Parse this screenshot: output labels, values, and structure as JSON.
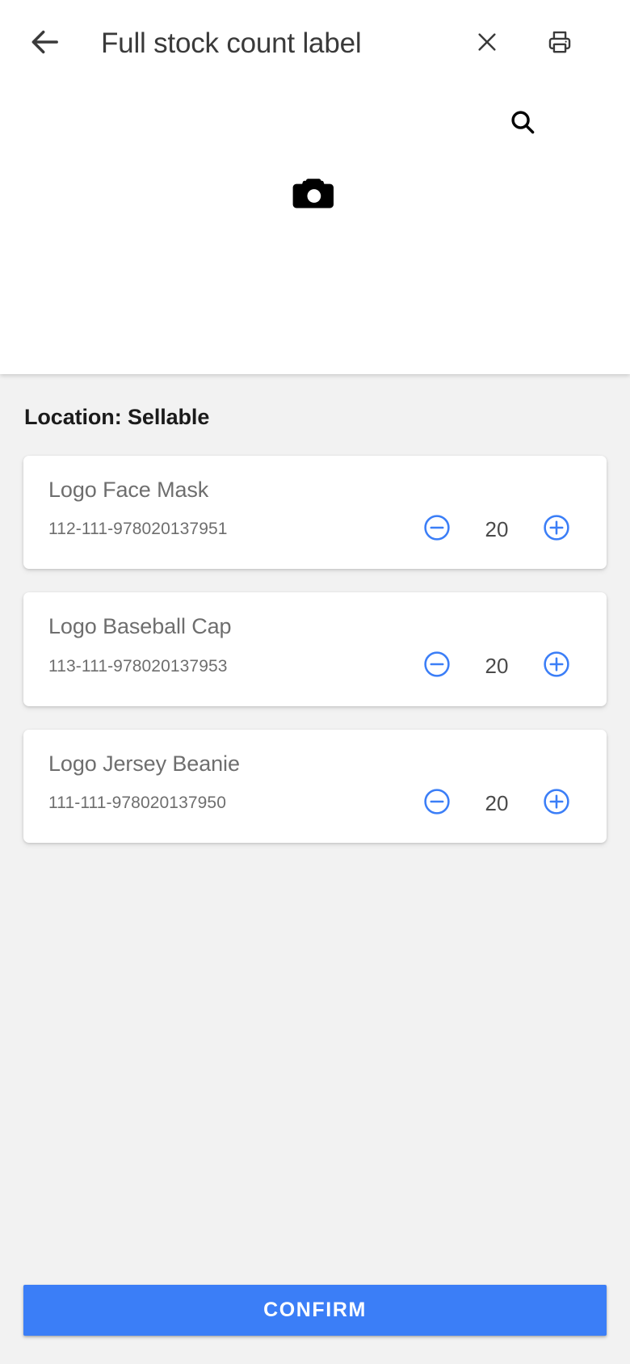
{
  "appbar": {
    "title": "Full stock count label",
    "back_icon": "arrow-left-icon",
    "close_icon": "close-icon",
    "print_icon": "printer-icon"
  },
  "scanner": {
    "search_icon": "search-icon",
    "camera_icon": "camera-icon"
  },
  "content": {
    "location_heading": "Location: Sellable",
    "items": [
      {
        "name": "Logo Face Mask",
        "sku": "112-111-978020137951",
        "quantity": "20",
        "decrement_label": "−",
        "increment_label": "+"
      },
      {
        "name": "Logo Baseball Cap",
        "sku": "113-111-978020137953",
        "quantity": "20",
        "decrement_label": "−",
        "increment_label": "+"
      },
      {
        "name": "Logo Jersey Beanie",
        "sku": "111-111-978020137950",
        "quantity": "20",
        "decrement_label": "−",
        "increment_label": "+"
      }
    ]
  },
  "footer": {
    "confirm_label": "CONFIRM"
  },
  "colors": {
    "accent_blue": "#3b7ef7",
    "stepper_blue": "#3b7ef7",
    "page_bg": "#f2f2f2",
    "card_bg": "#ffffff",
    "title_text": "#3a3a3a",
    "body_text": "#6e6e6e",
    "heading_text": "#1b1b1b"
  }
}
